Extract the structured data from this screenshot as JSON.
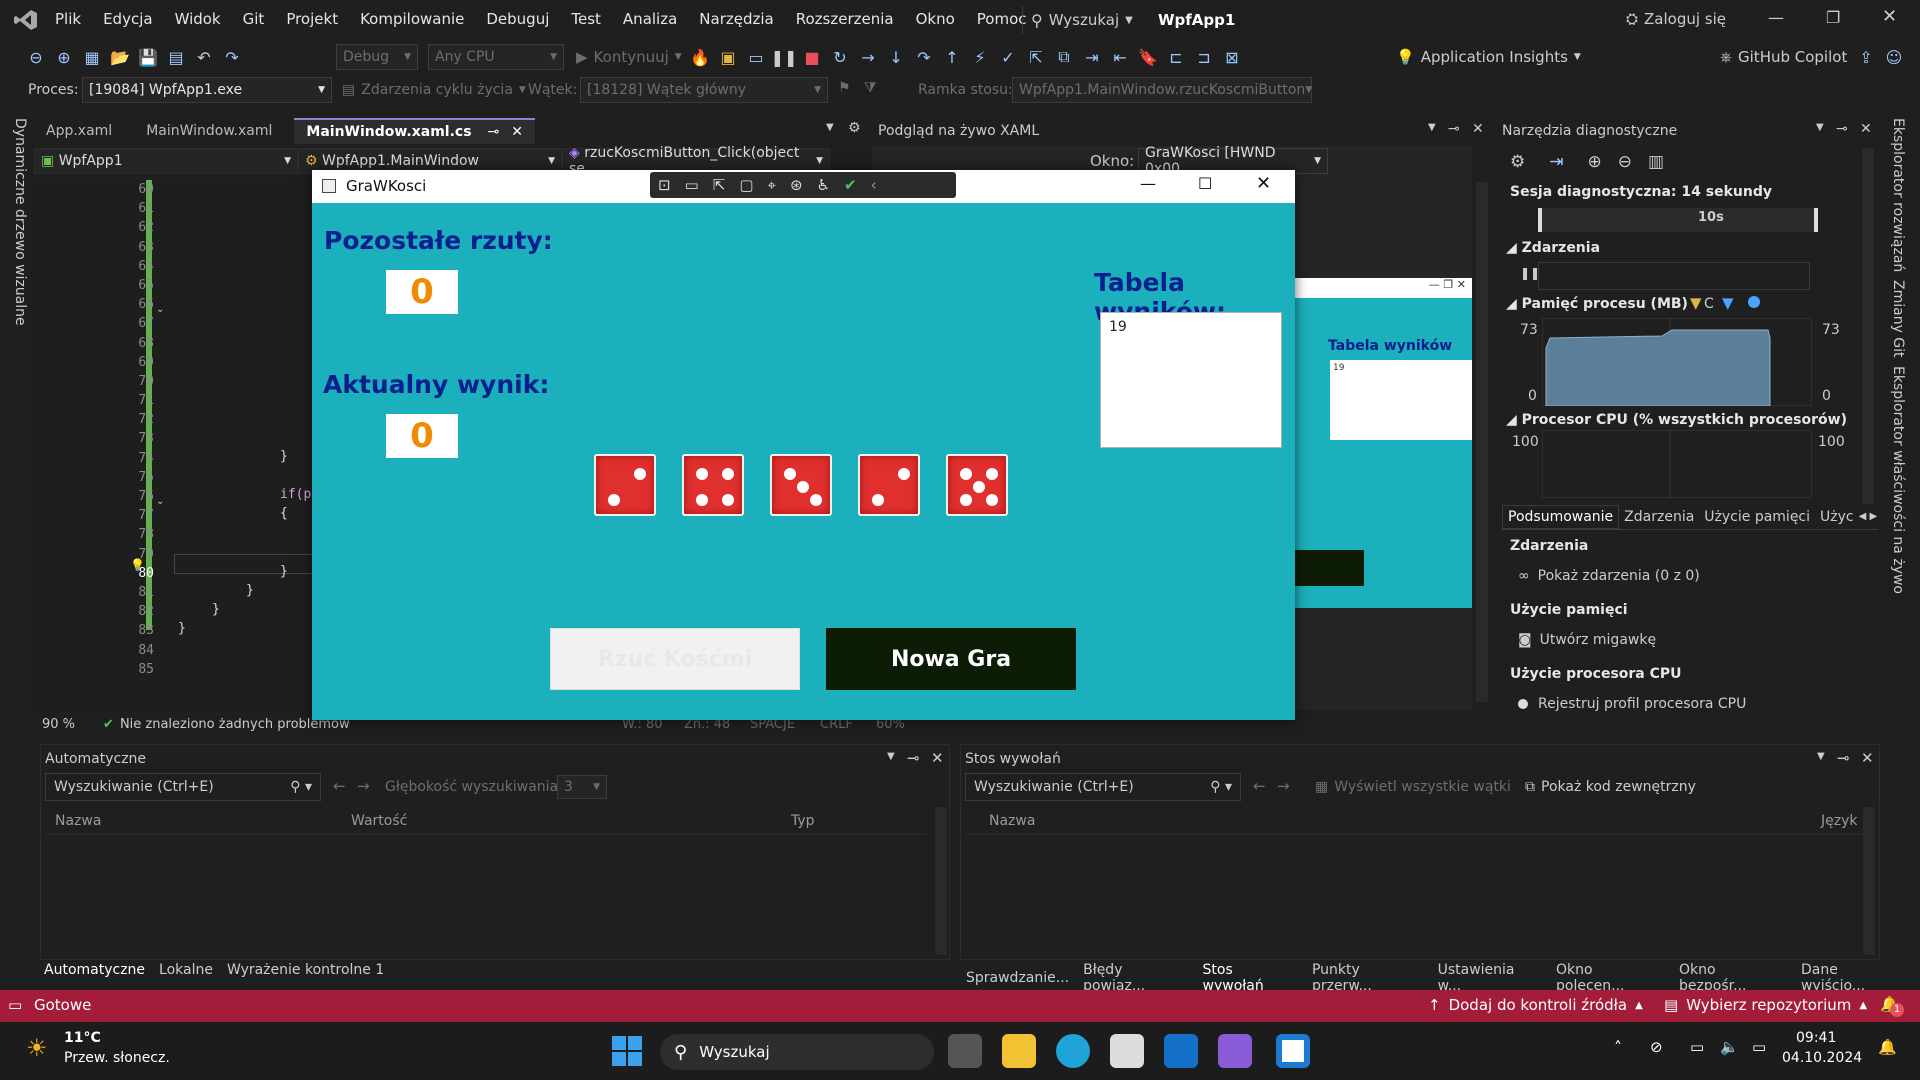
{
  "menu": [
    "Plik",
    "Edycja",
    "Widok",
    "Git",
    "Projekt",
    "Kompilowanie",
    "Debuguj",
    "Test",
    "Analiza",
    "Narzędzia",
    "Rozszerzenia",
    "Okno",
    "Pomoc"
  ],
  "search_label": "Wyszukaj",
  "solution_title": "WpfApp1",
  "sign_in": "Zaloguj się",
  "toolbar": {
    "config": "Debug",
    "platform": "Any CPU",
    "continue": "Kontynuuj",
    "app_insights": "Application Insights",
    "copilot": "GitHub Copilot"
  },
  "procbar": {
    "proc_label": "Proces:",
    "proc_value": "[19084] WpfApp1.exe",
    "lifecycle": "Zdarzenia cyklu życia",
    "thread_label": "Wątek:",
    "thread_value": "[18128] Wątek główny",
    "frame_label": "Ramka stosu:",
    "frame_value": "WpfApp1.MainWindow.rzucKoscmiButton"
  },
  "left_vertical": "Dynamiczne drzewo wizualne",
  "right_vertical": [
    "Eksplorator rozwiązań",
    "Zmiany Git",
    "Eksplorator właściwości na żywo"
  ],
  "editor_tabs": [
    "App.xaml",
    "MainWindow.xaml",
    "MainWindow.xaml.cs"
  ],
  "editor_nav": {
    "project": "WpfApp1",
    "class": "WpfApp1.MainWindow",
    "member": "rzucKoscmiButton_Click(object se"
  },
  "line_numbers": [
    "60",
    "61",
    "62",
    "63",
    "64",
    "65",
    "66",
    "67",
    "68",
    "69",
    "70",
    "71",
    "72",
    "73",
    "74",
    "75",
    "76",
    "77",
    "78",
    "79",
    "80",
    "81",
    "82",
    "83",
    "84",
    "85"
  ],
  "code": {
    "l75": "}",
    "l77": "if(p",
    "l78": "{",
    "l81": "}",
    "l82": "}",
    "l83": "}",
    "l84": "}"
  },
  "editor_status": {
    "zoom": "90 %",
    "problems": "Nie znaleziono żadnych problemów",
    "ln": "W.: 80",
    "col": "Zn.: 48",
    "spaces": "SPACJE",
    "crlf": "CRLF",
    "zoom2": "60%"
  },
  "xaml_preview": {
    "title": "Podgląd na żywo XAML",
    "window_label": "Okno:",
    "window_value": "GraWKosci [HWND 0x00",
    "mini_table": "Tabela wyników",
    "mini_value": "19"
  },
  "app": {
    "title": "GraWKosci",
    "remaining_label": "Pozostałe rzuty:",
    "remaining_value": "0",
    "score_label": "Aktualny wynik:",
    "score_value": "0",
    "table_label": "Tabela wyników:",
    "table_values": [
      "19"
    ],
    "dice": [
      2,
      4,
      3,
      2,
      5
    ],
    "roll_button": "Rzuć Kośćmi",
    "new_game_button": "Nowa Gra"
  },
  "diag": {
    "title": "Narzędzia diagnostyczne",
    "session": "Sesja diagnostyczna: 14 sekundy",
    "time_tick": "10s",
    "events": "Zdarzenia",
    "memory": "Pamięć procesu (MB)",
    "mem_max": "73",
    "mem_min": "0",
    "mem_legend_c": "C",
    "cpu": "Procesor CPU (% wszystkich procesorów)",
    "cpu_max": "100",
    "tabs": [
      "Podsumowanie",
      "Zdarzenia",
      "Użycie pamięci",
      "Użyc"
    ],
    "sec_events": "Zdarzenia",
    "show_events": "Pokaż zdarzenia (0 z 0)",
    "sec_mem": "Użycie pamięci",
    "snapshot": "Utwórz migawkę",
    "sec_cpu": "Użycie procesora CPU",
    "record_cpu": "Rejestruj profil procesora CPU"
  },
  "autos": {
    "title": "Automatyczne",
    "search": "Wyszukiwanie (Ctrl+E)",
    "depth_label": "Głębokość wyszukiwania:",
    "depth": "3",
    "cols": [
      "Nazwa",
      "Wartość",
      "Typ"
    ],
    "tabs": [
      "Automatyczne",
      "Lokalne",
      "Wyrażenie kontrolne 1"
    ]
  },
  "callstack": {
    "title": "Stos wywołań",
    "search": "Wyszukiwanie (Ctrl+E)",
    "all_threads": "Wyświetl wszystkie wątki",
    "external": "Pokaż kod zewnętrzny",
    "cols": [
      "Nazwa",
      "Język"
    ],
    "tabs": [
      "Sprawdzanie...",
      "Błędy powiąz...",
      "Stos wywołań",
      "Punkty przerw...",
      "Ustawienia w...",
      "Okno polecen...",
      "Okno bezpośr...",
      "Dane wyjścio..."
    ]
  },
  "status": {
    "ready": "Gotowe",
    "source_control": "Dodaj do kontroli źródła",
    "repo": "Wybierz repozytorium",
    "notif": "1"
  },
  "taskbar": {
    "temp": "11°C",
    "weather": "Przew. słonecz.",
    "search": "Wyszukaj",
    "time": "09:41",
    "date": "04.10.2024"
  }
}
